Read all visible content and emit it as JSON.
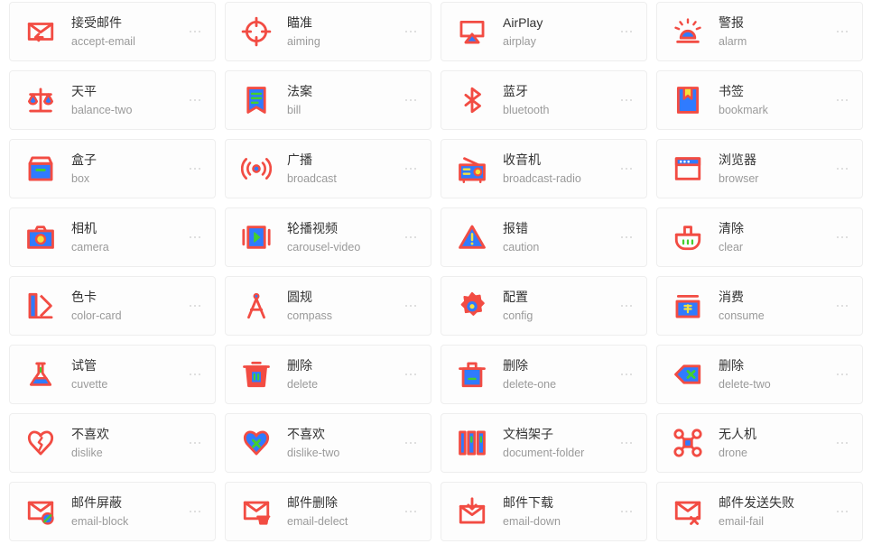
{
  "theme": {
    "stroke": "#F24C43",
    "fill_blue": "#2F7BFF",
    "fill_yellow": "#F5E13C",
    "fill_green": "#43CF2E",
    "card_bg": "#FDFDFD",
    "card_border": "#EEEEEE",
    "cn_text": "#333333",
    "en_text": "#9A9A9A",
    "dot": "#D5D5D5"
  },
  "more_menu": {
    "label": "...",
    "name": "more-options"
  },
  "icons": [
    {
      "cn": "接受邮件",
      "en": "accept-email",
      "icon": "accept-email-icon"
    },
    {
      "cn": "瞄准",
      "en": "aiming",
      "icon": "aiming-icon"
    },
    {
      "cn": "AirPlay",
      "en": "airplay",
      "icon": "airplay-icon"
    },
    {
      "cn": "警报",
      "en": "alarm",
      "icon": "alarm-icon"
    },
    {
      "cn": "天平",
      "en": "balance-two",
      "icon": "balance-two-icon"
    },
    {
      "cn": "法案",
      "en": "bill",
      "icon": "bill-icon"
    },
    {
      "cn": "蓝牙",
      "en": "bluetooth",
      "icon": "bluetooth-icon"
    },
    {
      "cn": "书签",
      "en": "bookmark",
      "icon": "bookmark-icon"
    },
    {
      "cn": "盒子",
      "en": "box",
      "icon": "box-icon"
    },
    {
      "cn": "广播",
      "en": "broadcast",
      "icon": "broadcast-icon"
    },
    {
      "cn": "收音机",
      "en": "broadcast-radio",
      "icon": "broadcast-radio-icon"
    },
    {
      "cn": "浏览器",
      "en": "browser",
      "icon": "browser-icon"
    },
    {
      "cn": "相机",
      "en": "camera",
      "icon": "camera-icon"
    },
    {
      "cn": "轮播视频",
      "en": "carousel-video",
      "icon": "carousel-video-icon"
    },
    {
      "cn": "报错",
      "en": "caution",
      "icon": "caution-icon"
    },
    {
      "cn": "清除",
      "en": "clear",
      "icon": "clear-icon"
    },
    {
      "cn": "色卡",
      "en": "color-card",
      "icon": "color-card-icon"
    },
    {
      "cn": "圆规",
      "en": "compass",
      "icon": "compass-icon"
    },
    {
      "cn": "配置",
      "en": "config",
      "icon": "config-icon"
    },
    {
      "cn": "消费",
      "en": "consume",
      "icon": "consume-icon"
    },
    {
      "cn": "试管",
      "en": "cuvette",
      "icon": "cuvette-icon"
    },
    {
      "cn": "删除",
      "en": "delete",
      "icon": "delete-icon"
    },
    {
      "cn": "删除",
      "en": "delete-one",
      "icon": "delete-one-icon"
    },
    {
      "cn": "删除",
      "en": "delete-two",
      "icon": "delete-two-icon"
    },
    {
      "cn": "不喜欢",
      "en": "dislike",
      "icon": "dislike-icon"
    },
    {
      "cn": "不喜欢",
      "en": "dislike-two",
      "icon": "dislike-two-icon"
    },
    {
      "cn": "文档架子",
      "en": "document-folder",
      "icon": "document-folder-icon"
    },
    {
      "cn": "无人机",
      "en": "drone",
      "icon": "drone-icon"
    },
    {
      "cn": "邮件屏蔽",
      "en": "email-block",
      "icon": "email-block-icon"
    },
    {
      "cn": "邮件删除",
      "en": "email-delect",
      "icon": "email-delect-icon"
    },
    {
      "cn": "邮件下载",
      "en": "email-down",
      "icon": "email-down-icon"
    },
    {
      "cn": "邮件发送失败",
      "en": "email-fail",
      "icon": "email-fail-icon"
    }
  ]
}
